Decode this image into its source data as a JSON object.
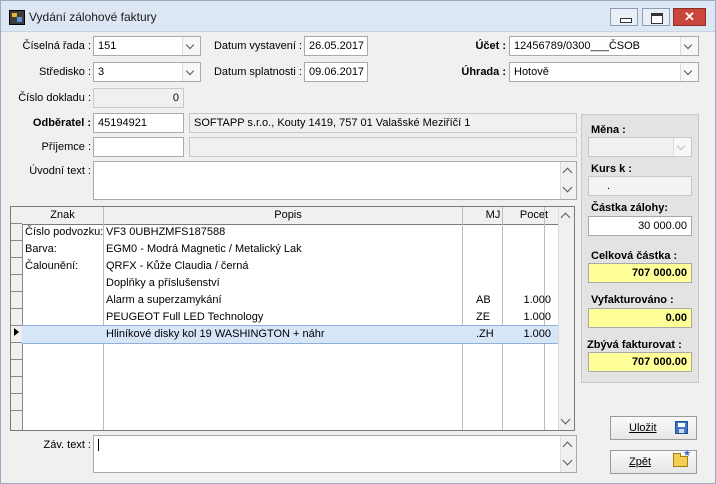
{
  "window": {
    "title": "Vydání zálohové faktury"
  },
  "header": {
    "ciselna_rada": {
      "label": "Číselná řada :",
      "value": "151"
    },
    "stredisko": {
      "label": "Středisko :",
      "value": "3"
    },
    "cislo_dokladu": {
      "label": "Číslo dokladu :",
      "value": "0"
    },
    "datum_vystaveni": {
      "label": "Datum vystavení :",
      "value": "26.05.2017"
    },
    "datum_splatnosti": {
      "label": "Datum splatnosti :",
      "value": "09.06.2017"
    },
    "ucet": {
      "label": "Účet :",
      "value": "12456789/0300___ČSOB"
    },
    "uhrada": {
      "label": "Úhrada :",
      "value": "Hotově"
    }
  },
  "partner": {
    "odberatel": {
      "label": "Odběratel :",
      "code": "45194921",
      "name": "SOFTAPP s.r.o., Kouty 1419, 757 01 Valašské Meziříčí 1"
    },
    "prijemce": {
      "label": "Příjemce :",
      "code": "",
      "name": ""
    },
    "uvodni_text": {
      "label": "Úvodní text :",
      "value": ""
    }
  },
  "panel": {
    "mena": {
      "label": "Měna :",
      "value": ""
    },
    "kurs": {
      "label": "Kurs  k :",
      "value": "."
    },
    "castka_zalohy": {
      "label": "Částka zálohy:",
      "value": "30 000.00"
    },
    "celkova_castka": {
      "label": "Celková částka :",
      "value": "707 000.00"
    },
    "vyfakturovano": {
      "label": "Vyfakturováno :",
      "value": "0.00"
    },
    "zbyva_fakturovat": {
      "label": "Zbývá fakturovat :",
      "value": "707 000.00"
    }
  },
  "grid": {
    "columns": [
      "Znak",
      "Popis",
      "MJ",
      "Pocet"
    ],
    "rows": [
      {
        "znak": "Číslo podvozku:",
        "popis": "VF3 0UBHZMFS187588",
        "mj": "",
        "pocet": ""
      },
      {
        "znak": "Barva:",
        "popis": "EGM0 - Modrá Magnetic / Metalický Lak",
        "mj": "",
        "pocet": ""
      },
      {
        "znak": "Čalounění:",
        "popis": "QRFX - Kůže Claudia / černá",
        "mj": "",
        "pocet": ""
      },
      {
        "znak": "",
        "popis": "Doplňky a příslušenství",
        "mj": "",
        "pocet": ""
      },
      {
        "znak": "",
        "popis": "Alarm a superzamykání",
        "mj": "AB",
        "pocet": "1.000"
      },
      {
        "znak": "",
        "popis": "PEUGEOT Full LED Technology",
        "mj": "ZE",
        "pocet": "1.000"
      },
      {
        "znak": "",
        "popis": "Hliníkové disky kol 19 WASHINGTON + náhr",
        "mj": ".ZH",
        "pocet": "1.000"
      }
    ],
    "selected_index": 6
  },
  "footer": {
    "zav_text": {
      "label": "Záv. text :",
      "value": ""
    },
    "save_label": "Uložit",
    "back_label": "Zpět"
  }
}
